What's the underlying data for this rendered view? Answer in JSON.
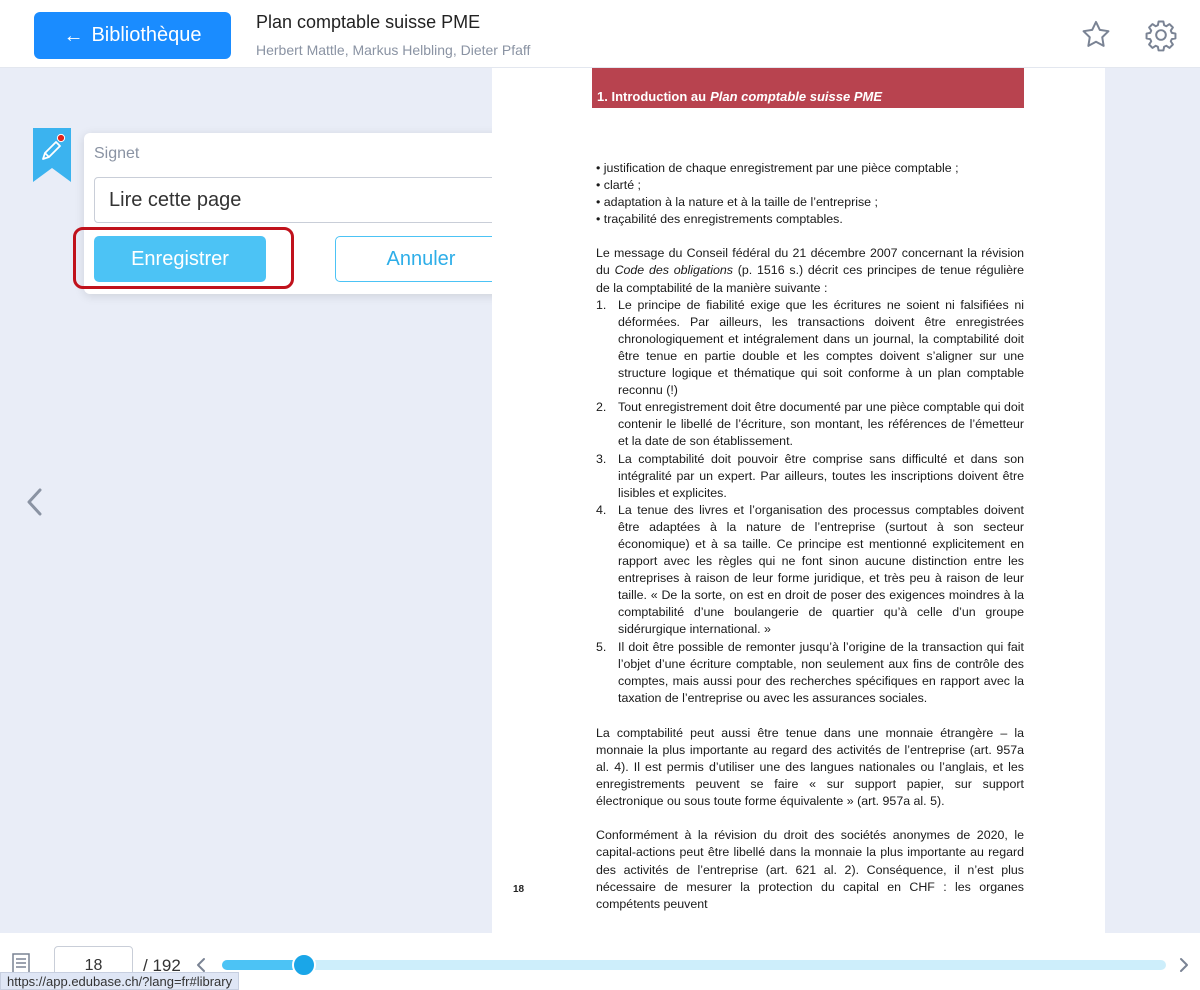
{
  "header": {
    "back_label": "Bibliothèque",
    "title": "Plan comptable suisse PME",
    "authors": "Herbert Mattle, Markus Helbling, Dieter Pfaff"
  },
  "bookmark_popup": {
    "label": "Signet",
    "input_value": "Lire cette page",
    "save_label": "Enregistrer",
    "cancel_label": "Annuler"
  },
  "page": {
    "chapter_prefix": "1. Introduction au",
    "chapter_italic": "Plan comptable suisse PME",
    "bullets": [
      "justification de chaque enregistrement par une pièce comptable ;",
      "clarté ;",
      "adaptation à la nature et à la taille de l’entreprise ;",
      "traçabilité des enregistrements comptables."
    ],
    "intro_before": "Le message du Conseil fédéral du 21 décembre 2007 concernant la révision du ",
    "intro_italic": "Code des obligations",
    "intro_after": " (p. 1516 s.) décrit ces principes de tenue régulière de la comptabilité de la manière suivante :",
    "list": [
      {
        "num": "1.",
        "text": "Le principe de fiabilité exige que les écritures ne soient ni falsifiées ni déformées. Par ailleurs, les transactions doivent être enregistrées chronologiquement et intégralement dans un journal, la comptabilité doit être tenue en partie double et les comptes doivent s’aligner sur une structure logique et thématique qui soit conforme à un plan comptable reconnu (!)"
      },
      {
        "num": "2.",
        "text": "Tout enregistrement doit être documenté par une pièce comptable qui doit contenir le libellé de l’écriture, son montant, les références de l’émetteur et la date de son établissement."
      },
      {
        "num": "3.",
        "text": "La comptabilité doit pouvoir être comprise sans difficulté et dans son intégralité par un expert. Par ailleurs, toutes les inscriptions doivent être lisibles et explicites."
      },
      {
        "num": "4.",
        "text": "La tenue des livres et l’organisation des processus comptables doivent être adaptées à la nature de l’entreprise (surtout à son secteur économique) et à sa taille. Ce principe est mentionné explicitement en rapport avec les règles qui ne font sinon aucune distinction entre les entreprises à raison de leur forme juridique, et très peu à raison de leur taille. « De la sorte, on est en droit de poser des exigences moindres à la comptabilité d’une boulangerie de quartier qu’à celle d’un groupe sidérurgique international. »"
      },
      {
        "num": "5.",
        "text": "Il doit être possible de remonter jusqu’à l’origine de la transaction qui fait l’objet d’une écriture comptable, non seulement aux fins de contrôle des comptes, mais aussi pour des recherches spécifiques en rapport avec la taxation de l’entreprise ou avec les assurances sociales."
      }
    ],
    "para2": "La comptabilité peut aussi être tenue dans une monnaie étrangère – la monnaie la plus importante au regard des activités de l’entreprise (art. 957a al. 4). Il est permis d’utiliser une des langues nationales ou l’anglais, et les enregistrements peuvent se faire « sur support papier, sur support électronique ou sous toute forme équivalente » (art. 957a al. 5).",
    "para3": "Conformément à la révision du droit des sociétés anonymes de 2020, le capital-actions peut être libellé dans la monnaie la plus importante au regard des activités de l’entreprise (art. 621 al. 2). Conséquence, il n’est plus nécessaire de mesurer la protection du capital en CHF : les organes compétents peuvent",
    "page_number": "18"
  },
  "footer": {
    "current_page": "18",
    "total_pages": "/ 192",
    "progress": 0.087
  },
  "status_url": "https://app.edubase.ch/?lang=fr#library",
  "colors": {
    "primary": "#1a8cff",
    "accent": "#4cc3f5",
    "chapter_banner": "#b8434f",
    "highlight": "#c0121c"
  }
}
